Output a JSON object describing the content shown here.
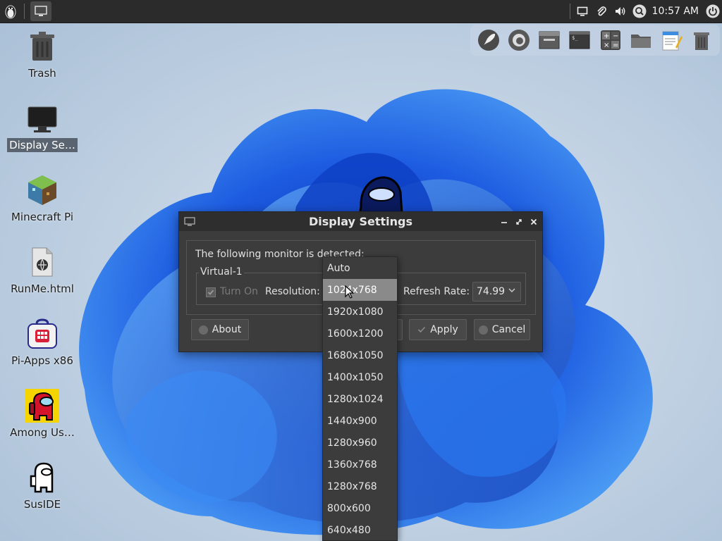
{
  "panel": {
    "clock": "10:57 AM"
  },
  "dock": {
    "icons": [
      "rocket-icon",
      "firefox-icon",
      "file-manager-icon",
      "terminal-icon",
      "calculator-icon",
      "folder-icon",
      "text-editor-icon",
      "trash-icon"
    ]
  },
  "desktop": {
    "icons": [
      {
        "label": "Trash",
        "icon": "trash-icon"
      },
      {
        "label": "Display Se…",
        "icon": "monitor-icon",
        "selected": true
      },
      {
        "label": "Minecraft Pi",
        "icon": "minecraft-icon"
      },
      {
        "label": "RunMe.html",
        "icon": "html-file-icon"
      },
      {
        "label": "Pi-Apps x86",
        "icon": "pi-apps-icon"
      },
      {
        "label": "Among Us…",
        "icon": "among-us-icon"
      },
      {
        "label": "SusIDE",
        "icon": "suside-icon"
      }
    ]
  },
  "dialog": {
    "title": "Display Settings",
    "detected_text": "The following monitor is detected:",
    "monitor_name": "Virtual-1",
    "turn_on_label": "Turn On",
    "turn_on_checked": true,
    "resolution_label": "Resolution:",
    "refresh_label": "Refresh Rate:",
    "refresh_value": "74.99",
    "buttons": {
      "about": "About",
      "apply": "Apply",
      "cancel": "Cancel"
    }
  },
  "resolution_dropdown": {
    "selected": "1024x768",
    "options": [
      "Auto",
      "1024x768",
      "1920x1080",
      "1600x1200",
      "1680x1050",
      "1400x1050",
      "1280x1024",
      "1440x900",
      "1280x960",
      "1360x768",
      "1280x768",
      "800x600",
      "640x480"
    ]
  },
  "colors": {
    "panel_bg": "#2b2b2b",
    "dialog_bg": "#3c3c3c",
    "selected_item": "#8a8a8a",
    "wallpaper_blue": "#1f5fd9"
  }
}
